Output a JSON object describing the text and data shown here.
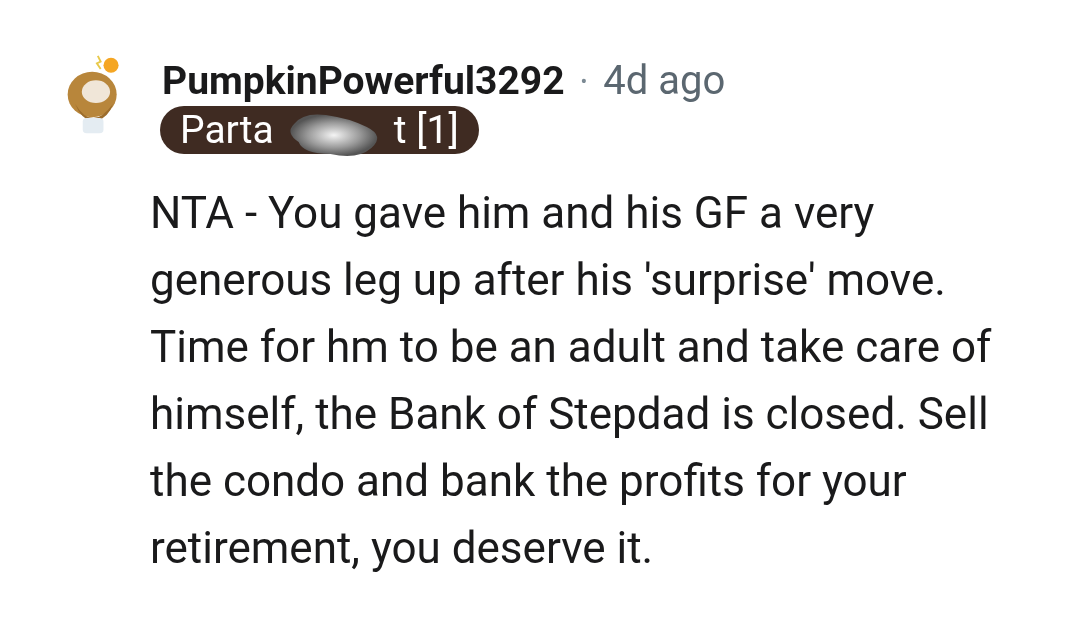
{
  "comment": {
    "author": "PumpkinPowerful3292",
    "separator": "•",
    "time": "4d ago",
    "flair": {
      "parts": [
        "Parta",
        "t [1]"
      ]
    },
    "body": "NTA - You gave him and his GF a very generous leg up after his 'surprise' move. Time for hm to be an adult and take care of himself, the Bank of Stepdad is closed. Sell the condo and bank the profits for your retirement, you deserve it."
  }
}
